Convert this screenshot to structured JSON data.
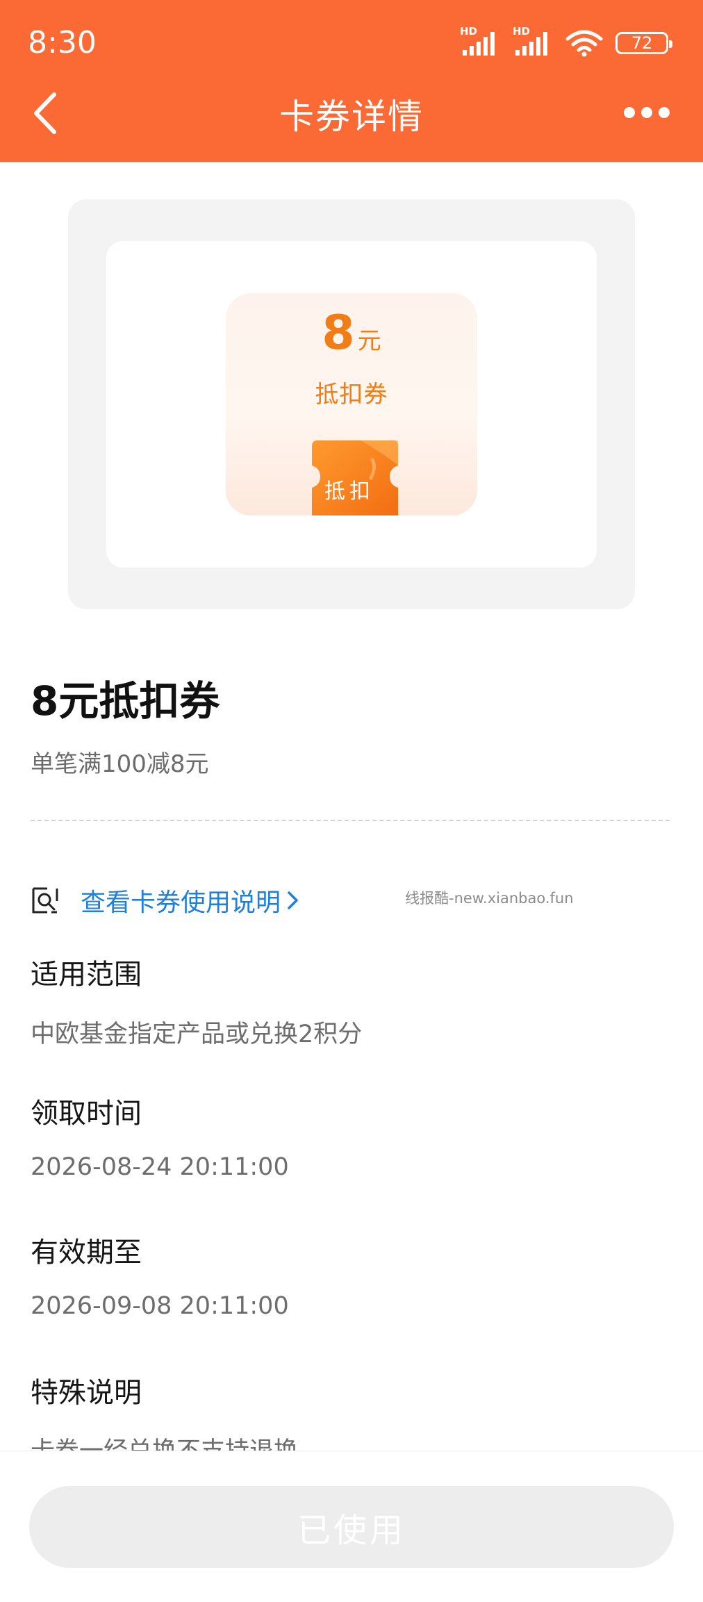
{
  "status_bar": {
    "time": "8:30",
    "network_1": "HD",
    "network_2": "HD",
    "battery": "72"
  },
  "header": {
    "title": "卡券详情"
  },
  "coupon_card": {
    "amount": "8",
    "unit": "元",
    "type": "抵扣券",
    "ticket_label": "抵扣",
    "accent_color": "#f07d16"
  },
  "coupon_info": {
    "name": "8元抵扣券",
    "rule": "单笔满100减8元",
    "instruction_link": "查看卡券使用说明",
    "watermark": "线报酷-new.xianbao.fun"
  },
  "details": [
    {
      "title": "适用范围",
      "value": "中欧基金指定产品或兑换2积分"
    },
    {
      "title": "领取时间",
      "value": "2026-08-24 20:11:00"
    },
    {
      "title": "有效期至",
      "value": "2026-09-08 20:11:00"
    },
    {
      "title": "特殊说明",
      "value": "卡券一经兑换不支持退换"
    }
  ],
  "bottom": {
    "button_label": "已使用"
  },
  "theme": {
    "header_color": "#fb6a34",
    "link_color": "#1f7fdc"
  }
}
